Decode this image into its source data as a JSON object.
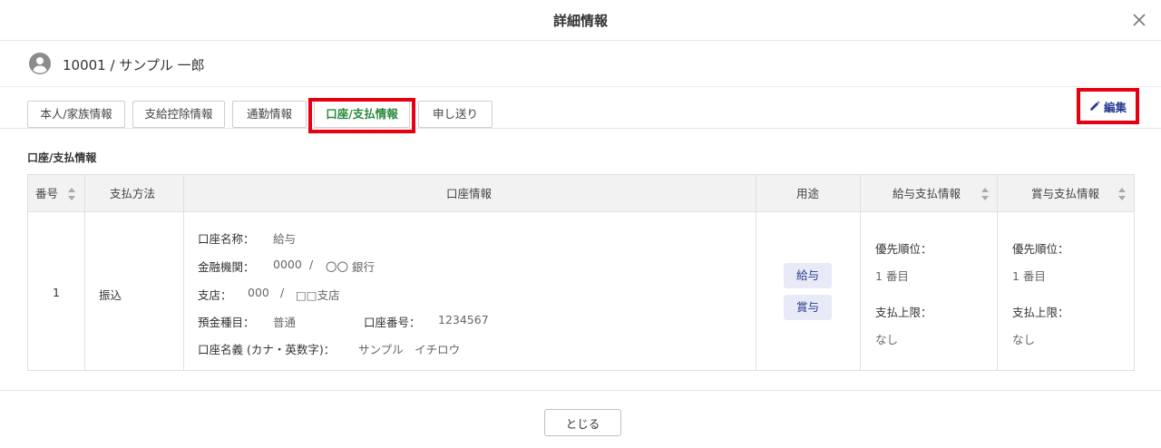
{
  "header": {
    "title": "詳細情報"
  },
  "user": {
    "label": "10001 / サンプル 一郎"
  },
  "tabs": [
    {
      "label": "本人/家族情報"
    },
    {
      "label": "支給控除情報"
    },
    {
      "label": "通勤情報"
    },
    {
      "label": "口座/支払情報"
    },
    {
      "label": "申し送り"
    }
  ],
  "active_tab": "口座/支払情報",
  "toolbar": {
    "edit_label": "編集"
  },
  "section": {
    "title": "口座/支払情報"
  },
  "table": {
    "columns": [
      "番号",
      "支払方法",
      "口座情報",
      "用途",
      "給与支払情報",
      "賞与支払情報"
    ],
    "row": {
      "number": "1",
      "method": "振込",
      "account": {
        "name_label": "口座名称：",
        "name_value": "給与",
        "bank_label": "金融機関：",
        "bank_code": "0000",
        "bank_sep": "/",
        "bank_name": "〇〇 銀行",
        "branch_label": "支店：",
        "branch_code": "000",
        "branch_sep": "/",
        "branch_name": "□□支店",
        "deposit_type_label": "預金種目：",
        "deposit_type_value": "普通",
        "account_no_label": "口座番号：",
        "account_no_value": "1234567",
        "holder_label": "口座名義 (カナ・英数字)：",
        "holder_value": "サンプル　イチロウ"
      },
      "usages": [
        "給与",
        "賞与"
      ],
      "salary": {
        "priority_label": "優先順位：",
        "priority_value": "1 番目",
        "limit_label": "支払上限：",
        "limit_value": "なし"
      },
      "bonus": {
        "priority_label": "優先順位：",
        "priority_value": "1 番目",
        "limit_label": "支払上限：",
        "limit_value": "なし"
      }
    }
  },
  "footer": {
    "close_label": "とじる"
  },
  "colors": {
    "accent_green": "#2a8a3c",
    "accent_navy": "#2a3b8f",
    "highlight_red": "#e60012"
  }
}
